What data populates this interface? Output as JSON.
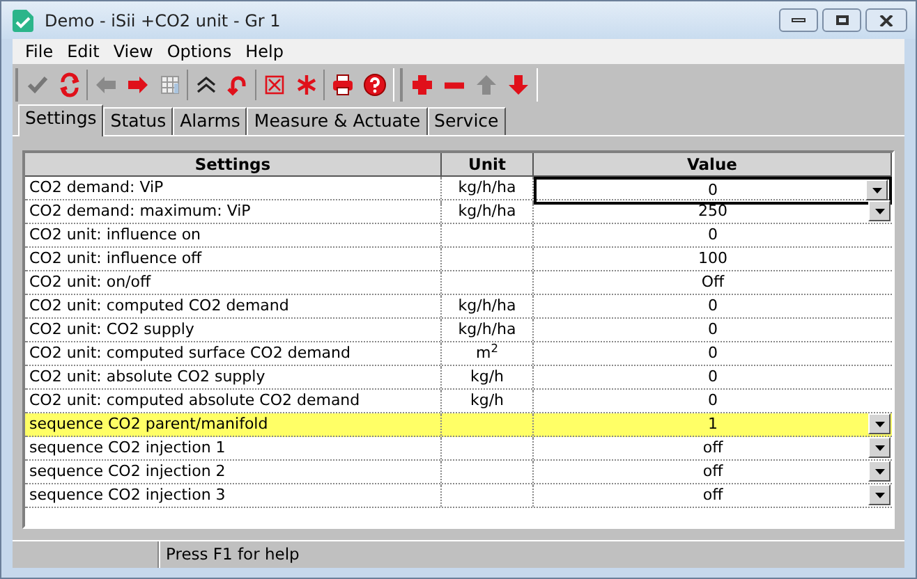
{
  "window": {
    "title": "Demo - iSii +CO2 unit - Gr 1"
  },
  "menu": [
    "File",
    "Edit",
    "View",
    "Options",
    "Help"
  ],
  "toolbars": [
    [
      [
        {
          "kind": "check",
          "disabled": true
        },
        {
          "kind": "refresh",
          "disabled": false
        }
      ],
      [
        {
          "kind": "left",
          "disabled": true
        },
        {
          "kind": "right",
          "disabled": false
        },
        {
          "kind": "grid",
          "disabled": true
        }
      ],
      [
        {
          "kind": "collapse",
          "disabled": false
        },
        {
          "kind": "undo",
          "disabled": false
        }
      ],
      [
        {
          "kind": "xbox",
          "disabled": false
        },
        {
          "kind": "asterisk",
          "disabled": false
        }
      ],
      [
        {
          "kind": "print",
          "disabled": false
        },
        {
          "kind": "help",
          "disabled": false
        }
      ]
    ],
    [
      [
        {
          "kind": "plus",
          "disabled": false
        },
        {
          "kind": "minus",
          "disabled": false
        },
        {
          "kind": "up",
          "disabled": true
        },
        {
          "kind": "down",
          "disabled": false
        }
      ]
    ]
  ],
  "tabs": [
    {
      "label": "Settings",
      "selected": true
    },
    {
      "label": "Status",
      "selected": false
    },
    {
      "label": "Alarms",
      "selected": false
    },
    {
      "label": "Measure & Actuate",
      "selected": false
    },
    {
      "label": "Service",
      "selected": false
    }
  ],
  "table": {
    "columns": [
      "Settings",
      "Unit",
      "Value"
    ],
    "rows": [
      {
        "setting": "CO2 demand: ViP",
        "unit": "kg/h/ha",
        "value": "0",
        "dropdown": true,
        "focused": true,
        "selected": false
      },
      {
        "setting": "CO2 demand: maximum: ViP",
        "unit": "kg/h/ha",
        "value": "250",
        "dropdown": true,
        "focused": false,
        "selected": false
      },
      {
        "setting": "CO2 unit: influence on",
        "value": "0",
        "dropdown": false,
        "focused": false,
        "selected": false
      },
      {
        "setting": "CO2 unit: influence off",
        "value": "100",
        "dropdown": false,
        "focused": false,
        "selected": false
      },
      {
        "setting": "CO2 unit: on/off",
        "value": "Off",
        "dropdown": false,
        "focused": false,
        "selected": false
      },
      {
        "setting": "CO2 unit: computed CO2 demand",
        "unit": "kg/h/ha",
        "value": "0",
        "dropdown": false,
        "focused": false,
        "selected": false
      },
      {
        "setting": "CO2 unit: CO2 supply",
        "unit": "kg/h/ha",
        "value": "0",
        "dropdown": false,
        "focused": false,
        "selected": false
      },
      {
        "setting": "CO2 unit: computed surface CO2 demand",
        "unit": "m$^{2}$",
        "value": "0",
        "dropdown": false,
        "focused": false,
        "selected": false
      },
      {
        "setting": "CO2 unit: absolute CO2 supply",
        "unit": "kg/h",
        "value": "0",
        "dropdown": false,
        "focused": false,
        "selected": false
      },
      {
        "setting": "CO2 unit: computed absolute CO2 demand",
        "unit": "kg/h",
        "value": "0",
        "dropdown": false,
        "focused": false,
        "selected": false
      },
      {
        "setting": "sequence CO2 parent/manifold",
        "value": "1",
        "dropdown": true,
        "focused": false,
        "selected": true
      },
      {
        "setting": "sequence CO2 injection 1",
        "value": "off",
        "dropdown": true,
        "focused": false,
        "selected": false
      },
      {
        "setting": "sequence CO2 injection 2",
        "value": "off",
        "dropdown": true,
        "focused": false,
        "selected": false
      },
      {
        "setting": "sequence CO2 injection 3",
        "value": "off",
        "dropdown": true,
        "focused": false,
        "selected": false
      }
    ]
  },
  "status_bar": {
    "help": "Press F1 for help"
  }
}
